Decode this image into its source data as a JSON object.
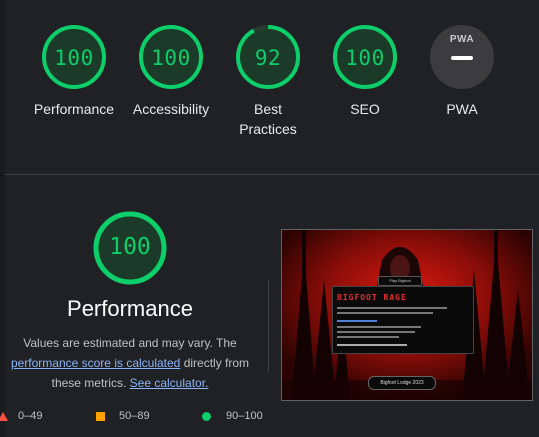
{
  "colors": {
    "pass": "#0cce6b",
    "average": "#ffa400",
    "fail": "#ff4e42",
    "link": "#8ab4f8",
    "background": "#202124"
  },
  "categories": [
    {
      "label": "Performance",
      "score": 100
    },
    {
      "label": "Accessibility",
      "score": 100
    },
    {
      "label": "Best Practices",
      "score": 92
    },
    {
      "label": "SEO",
      "score": 100
    },
    {
      "label": "PWA",
      "score": null,
      "badge": "PWA"
    }
  ],
  "main": {
    "score": 100,
    "title": "Performance",
    "desc_prefix": "Values are estimated and may vary. The",
    "desc_link1": "performance score is calculated",
    "desc_mid": "directly from these metrics.",
    "desc_link2": "See calculator."
  },
  "legend": [
    {
      "icon": "triangle-icon",
      "range": "0–49"
    },
    {
      "icon": "square-icon",
      "range": "50–89"
    },
    {
      "icon": "circle-icon",
      "range": "90–100"
    }
  ],
  "thumbnail": {
    "title": "BIGFOOT RAGE",
    "header_pill": "Play Bigfoot",
    "footer_pill": "Bigfoot Lodge 2023"
  }
}
